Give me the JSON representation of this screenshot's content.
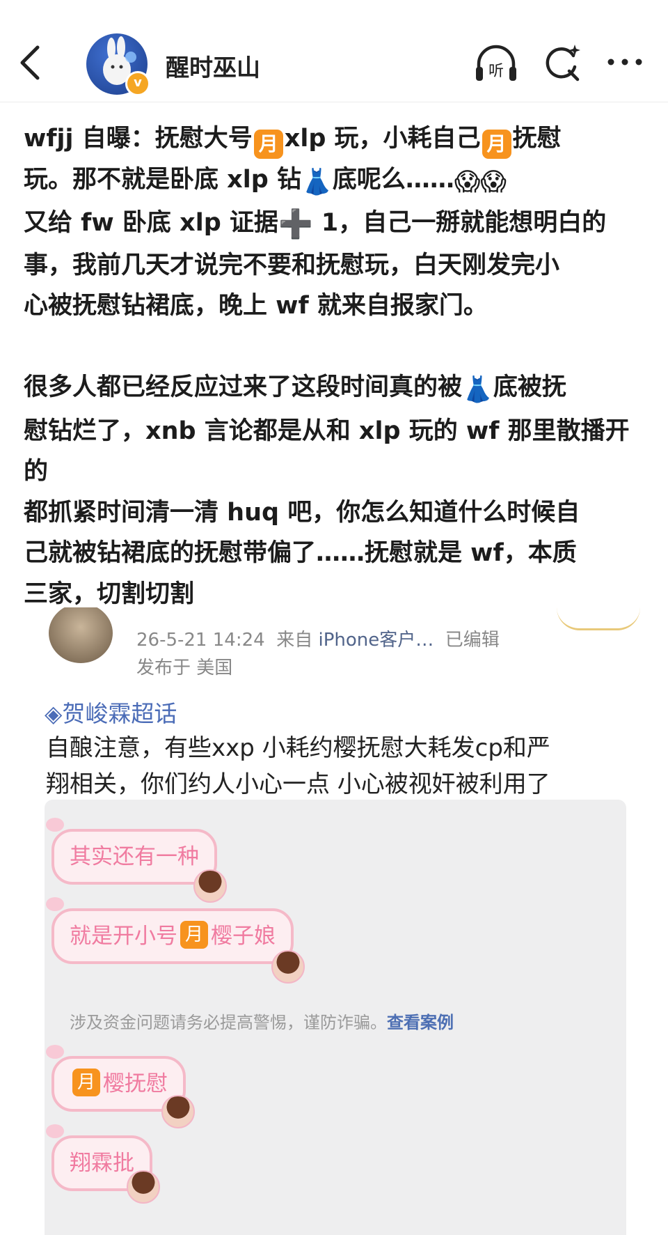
{
  "header": {
    "username": "醒时巫山",
    "listen_label": "听"
  },
  "post": {
    "line1_a": "wfjj 自曝：抚慰大号",
    "line1_b": "xlp 玩，小耗自己",
    "line1_c": "抚慰",
    "line2_a": "玩。那不就是卧底 xlp 钻",
    "line2_b": "底呢么……",
    "line3_a": "又给 fw 卧底 xlp 证据",
    "line3_b": " 1，自己一掰就能想明白的",
    "line4": "事，我前几天才说完不要和抚慰玩，白天刚发完小",
    "line5": "心被抚慰钻裙底，晚上 wf 就来自报家门。",
    "line6_a": "很多人都已经反应过来了这段时间真的被",
    "line6_b": "底被抚",
    "line7": "慰钻烂了，xnb 言论都是从和 xlp 玩的 wf 那里散播开",
    "line8": "的",
    "line9": "都抓紧时间清一清 huq 吧，你怎么知道什么时候自",
    "line10": "己就被钻裙底的抚慰带偏了……抚慰就是 wf，本质",
    "line11": "三家，切割切割",
    "moon_glyph": "月",
    "dress_emoji": "👗",
    "scream_emoji": "😱",
    "plus_emoji": "➕"
  },
  "embedded": {
    "meta_time": "26-5-21 14:24",
    "meta_from": "来自",
    "meta_client": "iPhone客户…",
    "meta_edited": "已编辑",
    "meta_location": "发布于 美国",
    "topic": "◈贺峻霖超话",
    "body_line1": "自酿注意，有些xxp 小耗约樱抚慰大耗发cp和严",
    "body_line2": "翔相关，你们约人小心一点  小心被视奸被利用了",
    "chat": {
      "bubble1": "其实还有一种",
      "bubble2_a": "就是开小号",
      "bubble2_b": "樱子娘",
      "notice": "涉及资金问题请务必提高警惕，谨防诈骗。",
      "notice_link": "查看案例",
      "bubble3": "樱抚慰",
      "bubble4": "翔霖批",
      "moon_glyph": "月"
    }
  },
  "colors": {
    "moon_badge": "#f7931e",
    "bubble_border": "#f5b9c8",
    "bubble_text": "#f07ba0",
    "topic_link": "#4b6cb7"
  }
}
